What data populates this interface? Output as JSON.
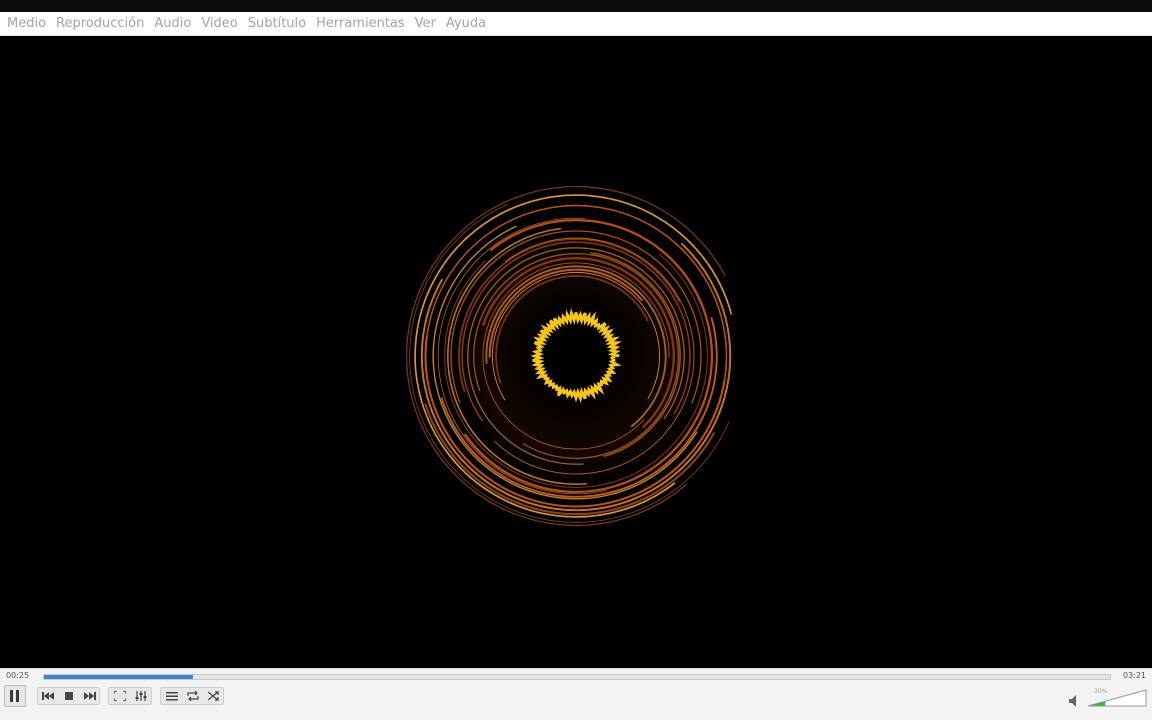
{
  "menu": {
    "items": [
      {
        "label": "Medio"
      },
      {
        "label": "Reproducción"
      },
      {
        "label": "Audio"
      },
      {
        "label": "Video"
      },
      {
        "label": "Subtítulo"
      },
      {
        "label": "Herramientas"
      },
      {
        "label": "Ver"
      },
      {
        "label": "Ayuda"
      }
    ]
  },
  "playback": {
    "elapsed": "00:25",
    "total": "03:21",
    "progress_fraction": 0.14
  },
  "volume": {
    "percent_label": "30%",
    "level_fraction": 0.3
  },
  "controls": {
    "icons": [
      "pause-icon",
      "previous-icon",
      "stop-icon",
      "next-icon",
      "fullscreen-icon",
      "extended-settings-icon",
      "playlist-icon",
      "loop-icon",
      "shuffle-icon",
      "volume-icon"
    ]
  },
  "colors": {
    "progress_fill": "#3d86d6",
    "volume_fill": "#4caf50",
    "visualizer_outer": "#c2551a",
    "visualizer_mid": "#e8892a",
    "visualizer_inner": "#f5c518"
  }
}
